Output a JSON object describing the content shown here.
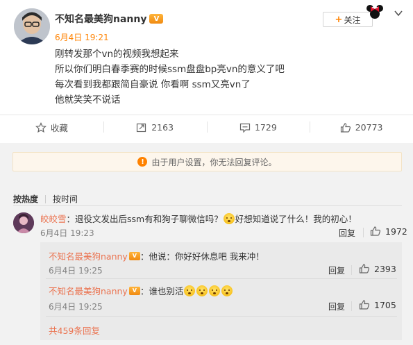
{
  "post": {
    "author": "不知名最美狗nanny",
    "vip_badge": "V",
    "time": "6月4日 19:21",
    "lines": [
      "刚转发那个vn的视频我想起来",
      "所以你们明白春季赛的时候ssm盘盘bp亮vn的意义了吧",
      "每次看到我都跟简自豪说 你看啊 ssm又亮vn了",
      "他就笑笑不说话"
    ],
    "follow_label": "关注",
    "follow_plus": "+"
  },
  "actions": {
    "favorite": "收藏",
    "repost": "2163",
    "comment": "1729",
    "like": "20773"
  },
  "notice": {
    "icon": "!",
    "text": "由于用户设置，你无法回复评论。"
  },
  "sort": {
    "hot": "按热度",
    "time": "按时间"
  },
  "comment": {
    "user": "皎皎雪",
    "text_a": "：退役文发出后ssm有和狗子聊微信吗？",
    "text_b": "好想知道说了什么！我的初心！",
    "time": "6月4日 19:23",
    "reply": "回复",
    "likes": "1972"
  },
  "replies": [
    {
      "user": "不知名最美狗nanny",
      "text": "：他说：你好好休息吧 我来冲！",
      "time": "6月4日 19:25",
      "reply": "回复",
      "likes": "2393"
    },
    {
      "user": "不知名最美狗nanny",
      "text": "：谁也别活",
      "time": "6月4日 19:25",
      "reply": "回复",
      "likes": "1705"
    }
  ],
  "more_replies": "共459条回复",
  "colors": {
    "accent": "#ff8200",
    "username": "#eb7350",
    "notice_bg": "#fdf6ec"
  },
  "icons": [
    "avatar",
    "vip-icon",
    "minnie-icon",
    "chevron-down-icon",
    "star-icon",
    "repost-icon",
    "comment-icon",
    "like-icon",
    "warning-icon",
    "emoji-icon"
  ]
}
